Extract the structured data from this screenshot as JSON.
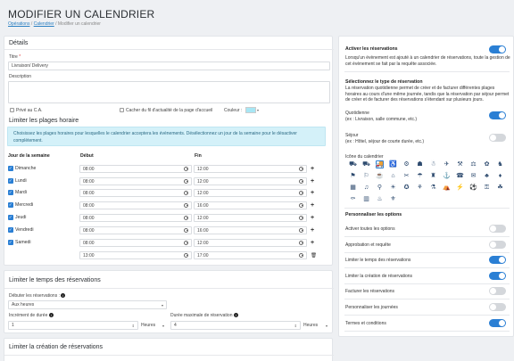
{
  "page": {
    "title": "Modifier un calendrier",
    "breadcrumb": {
      "item1": "Opérations",
      "sep": "/",
      "item2": "Calendrier",
      "item3": "Modifier un calendrier"
    }
  },
  "details": {
    "heading": "Détails",
    "title_label": "Titre",
    "title_req": "*",
    "title_value": "Livraison/ Delivery",
    "desc_label": "Description",
    "private_label": "Privé au C.A.",
    "hide_feed_label": "Cacher du fil d'actualité de la page d'accueil",
    "color_label": "Couleur :",
    "color_value": "#a7e6f4"
  },
  "hours": {
    "heading": "Limiter les plages horaire",
    "info": "Choisissez les plages horaires pour lesquelles le calendrier acceptera les évènements. Désélectionnez un jour de la semaine pour le désactiver complètement.",
    "col_day": "Jour de la semaine",
    "col_start": "Début",
    "col_end": "Fin",
    "rows": [
      {
        "day": "Dimanche",
        "start": "08:00",
        "end": "12:00"
      },
      {
        "day": "Lundi",
        "start": "08:00",
        "end": "12:00"
      },
      {
        "day": "Mardi",
        "start": "08:00",
        "end": "12:00"
      },
      {
        "day": "Mercredi",
        "start": "08:00",
        "end": "16:00"
      },
      {
        "day": "Jeudi",
        "start": "08:00",
        "end": "12:00"
      },
      {
        "day": "Vendredi",
        "start": "08:00",
        "end": "16:00"
      },
      {
        "day": "Samedi",
        "start": "08:00",
        "end": "12:00"
      },
      {
        "day": "",
        "start": "13:00",
        "end": "17:00"
      }
    ]
  },
  "time_limit": {
    "heading": "Limiter le temps des réservations",
    "start_label": "Débuter les réservations :",
    "start_value": "Aux heures",
    "inc_label": "Incrément de durée",
    "inc_value": "1",
    "inc_unit": "Heures",
    "max_label": "Durée maximale de réservation",
    "max_value": "4",
    "max_unit": "Heures"
  },
  "create_limit": {
    "heading": "Limiter la création de réservations"
  },
  "right": {
    "activate_label": "Activer les réservations",
    "activate_desc": "Lorsqu'un évènement est ajouté à un calendrier de réservations, toute la gestion de cet évènement se fait par la requête associée.",
    "type_heading": "Sélectionnez le type de réservation",
    "type_desc": "La réservation quotidienne permet de créer et de facturer différentes plages horaires au cours d'une même journée, tandis que la réservation par séjour permet de créer et de facturer des réservations s'étendant sur plusieurs jours.",
    "daily_label": "Quotidienne",
    "daily_example": "(ex : Livraison, salle commune, etc.)",
    "stay_label": "Séjour",
    "stay_example": "(ex : Hôtel, séjour de courte durée, etc.)",
    "icon_heading": "Icône du calendrier",
    "options_heading": "Personnaliser les options",
    "options": [
      {
        "label": "Activer toutes les options",
        "on": false
      },
      {
        "label": "Approbation et requête",
        "on": false
      },
      {
        "label": "Limiter le temps des réservations",
        "on": true
      },
      {
        "label": "Limiter la création de réservations",
        "on": true
      },
      {
        "label": "Facturer les réservations",
        "on": false
      },
      {
        "label": "Personnaliser les journées",
        "on": false
      },
      {
        "label": "Termes et conditions",
        "on": true
      }
    ]
  },
  "colors": {
    "accent": "#2a7fd4",
    "info_bg": "#d4f1f9",
    "toggle_off": "#d4d7db"
  }
}
